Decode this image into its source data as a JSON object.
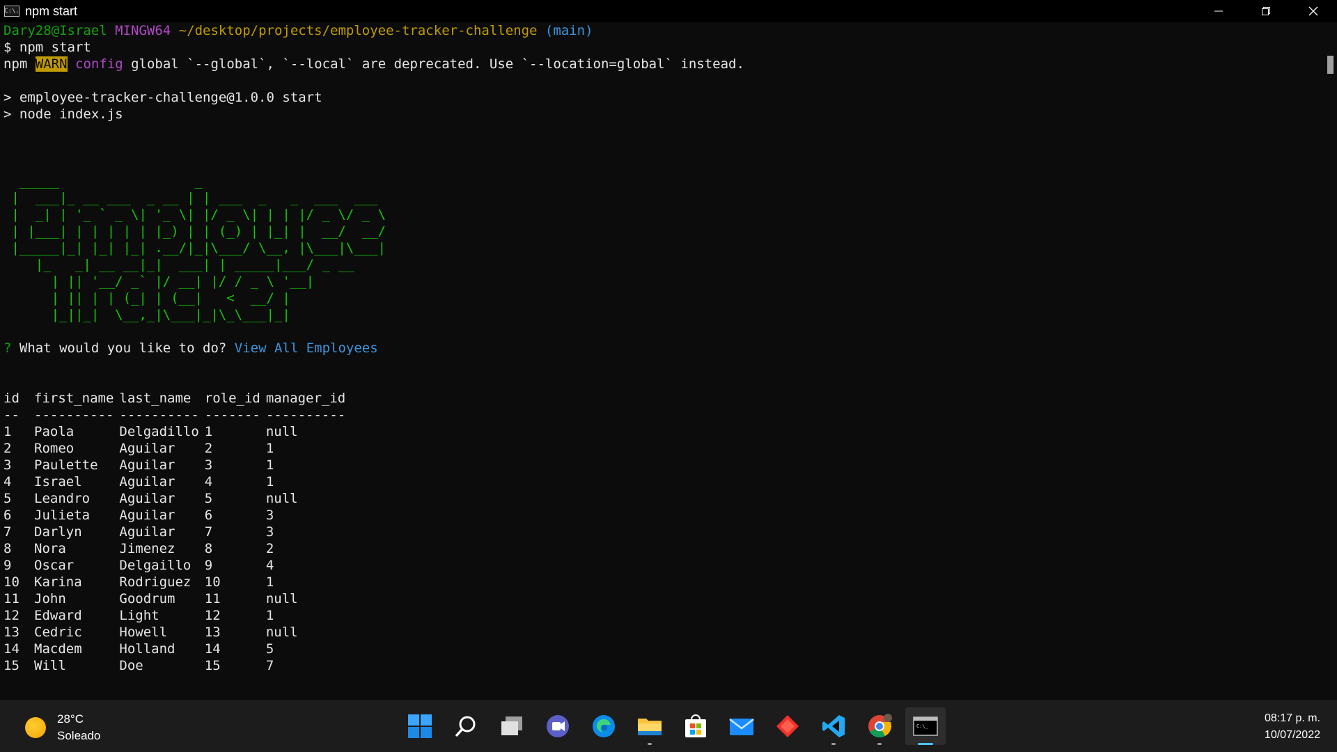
{
  "window": {
    "title": "npm start",
    "icon_text": "C:\\."
  },
  "prompt": {
    "user_host": "Dary28@Israel",
    "env": "MINGW64",
    "path": "~/desktop/projects/employee-tracker-challenge",
    "branch": "(main)",
    "command": "$ npm start"
  },
  "warn": {
    "npm": "npm",
    "label": "WARN",
    "config": "config",
    "message": "global `--global`, `--local` are deprecated. Use `--location=global` instead."
  },
  "script_lines": [
    "> employee-tracker-challenge@1.0.0 start",
    "> node index.js"
  ],
  "ascii_art": "  _____                 _                             \n |  ___|_ __ ___  _ __ | | ___  _   _  ___  ___       \n |  _| | '_ ` _ \\| '_ \\| |/ _ \\| | | |/ _ \\/ _ \\      \n | |___| | | | | | |_) | | (_) | |_| |  __/  __/      \n |_____|_| |_| |_| .__/|_|\\___/ \\__, |\\___|\\___|      \n    |_   _| __ __|_|  ___| | _____|___/ _ __          \n      | || '__/ _` |/ __| |/ / _ \\ '__|               \n      | || | | (_| | (__|   <  __/ |                  \n      |_||_|  \\__,_|\\___|_|\\_\\___|_|                  ",
  "question": {
    "mark": "?",
    "text": "What would you like to do?",
    "answer": "View All Employees"
  },
  "table": {
    "headers": [
      "id",
      "first_name",
      "last_name",
      "role_id",
      "manager_id"
    ],
    "separators": [
      "--",
      "----------",
      "----------",
      "-------",
      "----------"
    ],
    "rows": [
      [
        "1",
        "Paola",
        "Delgadillo",
        "1",
        "null"
      ],
      [
        "2",
        "Romeo",
        "Aguilar",
        "2",
        "1"
      ],
      [
        "3",
        "Paulette",
        "Aguilar",
        "3",
        "1"
      ],
      [
        "4",
        "Israel",
        "Aguilar",
        "4",
        "1"
      ],
      [
        "5",
        "Leandro",
        "Aguilar",
        "5",
        "null"
      ],
      [
        "6",
        "Julieta",
        "Aguilar",
        "6",
        "3"
      ],
      [
        "7",
        "Darlyn",
        "Aguilar",
        "7",
        "3"
      ],
      [
        "8",
        "Nora",
        "Jimenez",
        "8",
        "2"
      ],
      [
        "9",
        "Oscar",
        "Delgaillo",
        "9",
        "4"
      ],
      [
        "10",
        "Karina",
        "Rodriguez",
        "10",
        "1"
      ],
      [
        "11",
        "John",
        "Goodrum",
        "11",
        "null"
      ],
      [
        "12",
        "Edward",
        "Light",
        "12",
        "1"
      ],
      [
        "13",
        "Cedric",
        "Howell",
        "13",
        "null"
      ],
      [
        "14",
        "Macdem",
        "Holland",
        "14",
        "5"
      ],
      [
        "15",
        "Will",
        "Doe",
        "15",
        "7"
      ]
    ]
  },
  "taskbar": {
    "weather_temp": "28°C",
    "weather_desc": "Soleado",
    "time": "08:17 p. m.",
    "date": "10/07/2022",
    "icons": [
      "windows-start-icon",
      "search-icon",
      "task-view-icon",
      "teams-chat-icon",
      "edge-icon",
      "file-explorer-icon",
      "microsoft-store-icon",
      "mail-icon",
      "git-icon",
      "vscode-icon",
      "chrome-icon",
      "terminal-icon"
    ]
  },
  "colors": {
    "terminal_bg": "#0c0c0c",
    "prompt_green": "#13a10e",
    "prompt_purple": "#b148c6",
    "prompt_yellow": "#c19c00",
    "branch_cyan": "#3a96dd",
    "ascii_green": "#16c60c"
  }
}
